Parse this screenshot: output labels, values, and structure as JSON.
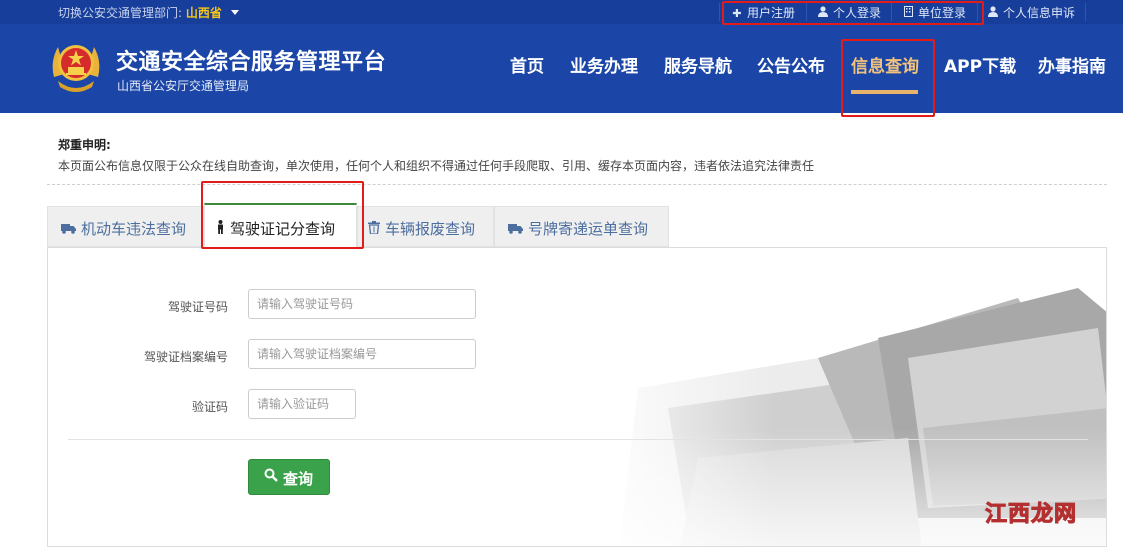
{
  "topbar": {
    "region_label": "切换公安交通管理部门:",
    "region_value": "山西省",
    "links": [
      {
        "label": "用户注册",
        "icon": "plus-icon"
      },
      {
        "label": "个人登录",
        "icon": "user-icon"
      },
      {
        "label": "单位登录",
        "icon": "building-icon"
      },
      {
        "label": "个人信息申诉",
        "icon": "user-icon"
      }
    ]
  },
  "header": {
    "title": "交通安全综合服务管理平台",
    "subtitle": "山西省公安厅交通管理局",
    "nav": [
      "首页",
      "业务办理",
      "服务导航",
      "公告公布",
      "信息查询",
      "APP下载",
      "办事指南"
    ],
    "active_nav": "信息查询"
  },
  "notice": {
    "title": "郑重申明:",
    "text": "本页面公布信息仅限于公众在线自助查询，单次使用，任何个人和组织不得通过任何手段爬取、引用、缓存本页面内容，违者依法追究法律责任"
  },
  "tabs": [
    {
      "label": "机动车违法查询",
      "icon": "truck-icon"
    },
    {
      "label": "驾驶证记分查询",
      "icon": "person-icon"
    },
    {
      "label": "车辆报废查询",
      "icon": "trash-icon"
    },
    {
      "label": "号牌寄递运单查询",
      "icon": "truck-icon"
    }
  ],
  "active_tab": "驾驶证记分查询",
  "form": {
    "license_label": "驾驶证号码",
    "license_placeholder": "请输入驾驶证号码",
    "file_label": "驾驶证档案编号",
    "file_placeholder": "请输入驾驶证档案编号",
    "captcha_label": "验证码",
    "captcha_placeholder": "请输入验证码",
    "submit_label": "查询"
  },
  "watermark": "江西龙网",
  "colors": {
    "header_blue": "#1b46a8",
    "topbar_blue": "#163e9a",
    "accent_gold": "#f0c27b",
    "button_green": "#3aa24a",
    "highlight_red": "#e21b1b"
  }
}
